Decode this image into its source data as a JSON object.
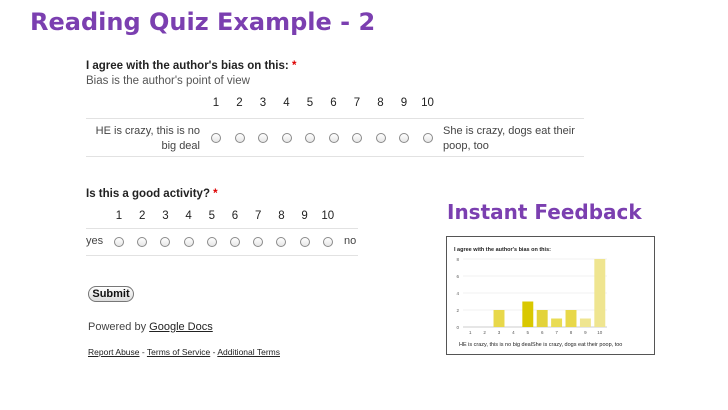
{
  "slide_title": "Reading Quiz Example - 2",
  "q1": {
    "title": "I agree with the author's bias on this:",
    "required_mark": "*",
    "help": "Bias is the author's point of view",
    "scale": [
      "1",
      "2",
      "3",
      "4",
      "5",
      "6",
      "7",
      "8",
      "9",
      "10"
    ],
    "low_label": "HE is crazy, this is no big deal",
    "high_label": "She is crazy, dogs eat their poop, too"
  },
  "q2": {
    "title": "Is this a good activity?",
    "required_mark": "*",
    "scale": [
      "1",
      "2",
      "3",
      "4",
      "5",
      "6",
      "7",
      "8",
      "9",
      "10"
    ],
    "low_label": "yes",
    "high_label": "no"
  },
  "submit_label": "Submit",
  "powered": {
    "prefix": "Powered by ",
    "link": "Google Docs"
  },
  "footer": {
    "report_abuse": "Report Abuse",
    "sep": " - ",
    "terms": "Terms of Service",
    "additional_terms": "Additional Terms"
  },
  "feedback_title": "Instant Feedback",
  "chart_data": {
    "type": "bar",
    "title": "I agree with the author's bias on this:",
    "categories": [
      "1",
      "2",
      "3",
      "4",
      "5",
      "6",
      "7",
      "8",
      "9",
      "10"
    ],
    "values": [
      0,
      0,
      2,
      0,
      3,
      2,
      1,
      2,
      1,
      8
    ],
    "ylim": [
      0,
      8
    ],
    "yticks": [
      "0",
      "2",
      "4",
      "6",
      "8"
    ],
    "colors": [
      "#e8d84a",
      "#e8d84a",
      "#e8d84a",
      "#e8d84a",
      "#d9c800",
      "#e3d33a",
      "#e9dc55",
      "#e8d84a",
      "#efe590",
      "#efe590"
    ],
    "xlabel": "HE is crazy, this is no big dealShe is crazy, dogs eat their poop, too",
    "grid": true
  }
}
